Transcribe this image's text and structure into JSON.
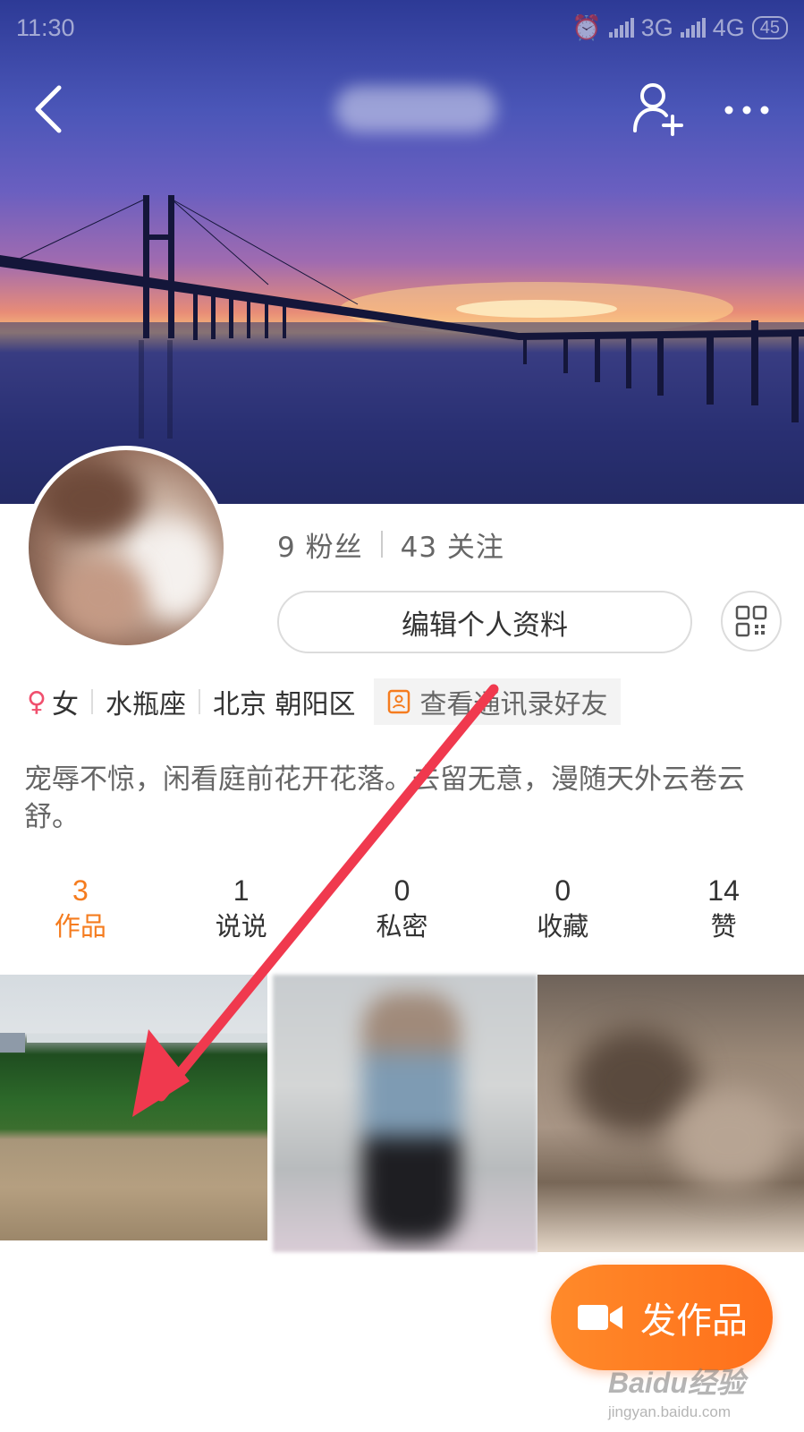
{
  "status_bar": {
    "time": "11:30",
    "network_1": "3G",
    "network_2": "4G",
    "battery": "45"
  },
  "header": {
    "back_icon": "chevron-left-icon",
    "add_friend_icon": "add-user-icon",
    "more_icon": "more-horizontal-icon"
  },
  "profile": {
    "followers_count": "9",
    "followers_label": "粉丝",
    "following_count": "43",
    "following_label": "关注",
    "edit_profile_label": "编辑个人资料",
    "gender": "女",
    "zodiac": "水瓶座",
    "location": "北京 朝阳区",
    "contacts_label": "查看通讯录好友",
    "bio": "宠辱不惊，闲看庭前花开花落。去留无意，漫随天外云卷云舒。"
  },
  "tabs": [
    {
      "count": "3",
      "label": "作品",
      "active": true
    },
    {
      "count": "1",
      "label": "说说",
      "active": false
    },
    {
      "count": "0",
      "label": "私密",
      "active": false
    },
    {
      "count": "0",
      "label": "收藏",
      "active": false
    },
    {
      "count": "14",
      "label": "赞",
      "active": false
    }
  ],
  "fab": {
    "label": "发作品",
    "icon": "video-camera-icon"
  },
  "watermark": {
    "main": "Baidu经验",
    "sub": "jingyan.baidu.com"
  },
  "colors": {
    "accent": "#f57c1f",
    "annotation_arrow": "#f0394e"
  }
}
